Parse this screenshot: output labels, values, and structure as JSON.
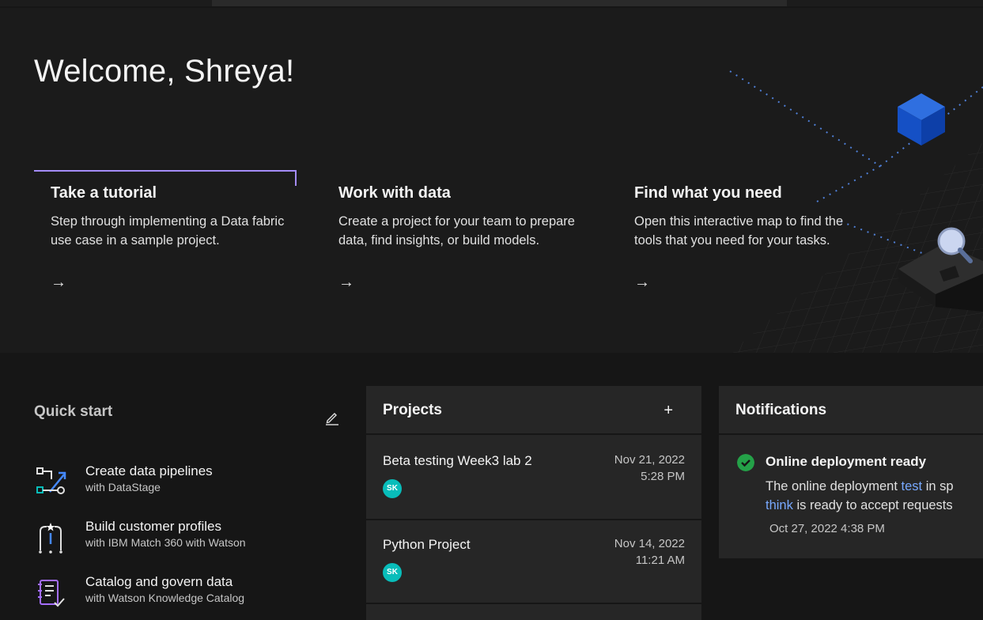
{
  "welcome": "Welcome, Shreya!",
  "cards": [
    {
      "title": "Take a tutorial",
      "desc": "Step through implementing a Data fabric use case in a sample project.",
      "arrow": "→"
    },
    {
      "title": "Work with data",
      "desc": "Create a project for your team to prepare data, find insights, or build models.",
      "arrow": "→"
    },
    {
      "title": "Find what you need",
      "desc": "Open this interactive map to find the tools that you need for your tasks.",
      "arrow": "→"
    }
  ],
  "quickstart": {
    "title": "Quick start",
    "items": [
      {
        "title": "Create data pipelines",
        "sub": "with DataStage",
        "icon": "pipeline-icon"
      },
      {
        "title": "Build customer profiles",
        "sub": "with IBM Match 360 with Watson",
        "icon": "profile-icon"
      },
      {
        "title": "Catalog and govern data",
        "sub": "with Watson Knowledge Catalog",
        "icon": "catalog-icon"
      }
    ]
  },
  "projects": {
    "title": "Projects",
    "add": "+",
    "rows": [
      {
        "name": "Beta testing Week3 lab 2",
        "date": "Nov 21, 2022",
        "time": "5:28 PM",
        "initials": "SK"
      },
      {
        "name": "Python Project",
        "date": "Nov 14, 2022",
        "time": "11:21 AM",
        "initials": "SK"
      }
    ]
  },
  "notifications": {
    "title": "Notifications",
    "item": {
      "title": "Online deployment ready",
      "line1_pre": "The online deployment ",
      "line1_link": "test",
      "line1_post": " in sp",
      "line2_link": "think",
      "line2_post": " is ready to accept requests",
      "date": "Oct 27, 2022 4:38 PM"
    }
  },
  "colors": {
    "accent": "#a48cf7",
    "success": "#24a148",
    "link": "#78a9ff",
    "avatar": "#08bdba"
  }
}
